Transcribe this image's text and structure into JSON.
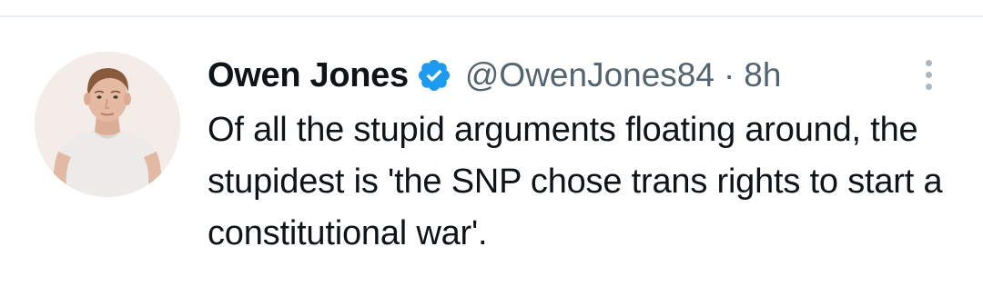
{
  "tweet": {
    "author": {
      "display_name": "Owen Jones",
      "handle": "@OwenJones84",
      "verified": true,
      "verified_color": "#1d9bf0"
    },
    "separator": "·",
    "timestamp": "8h",
    "text": "Of all the stupid arguments floating around, the stupidest is 'the SNP chose trans rights to start a constitutional war'.",
    "more_icon": "ellipsis-vertical-icon"
  },
  "colors": {
    "text_primary": "#0f1419",
    "text_secondary": "#536471",
    "divider": "#e6ecf0"
  }
}
